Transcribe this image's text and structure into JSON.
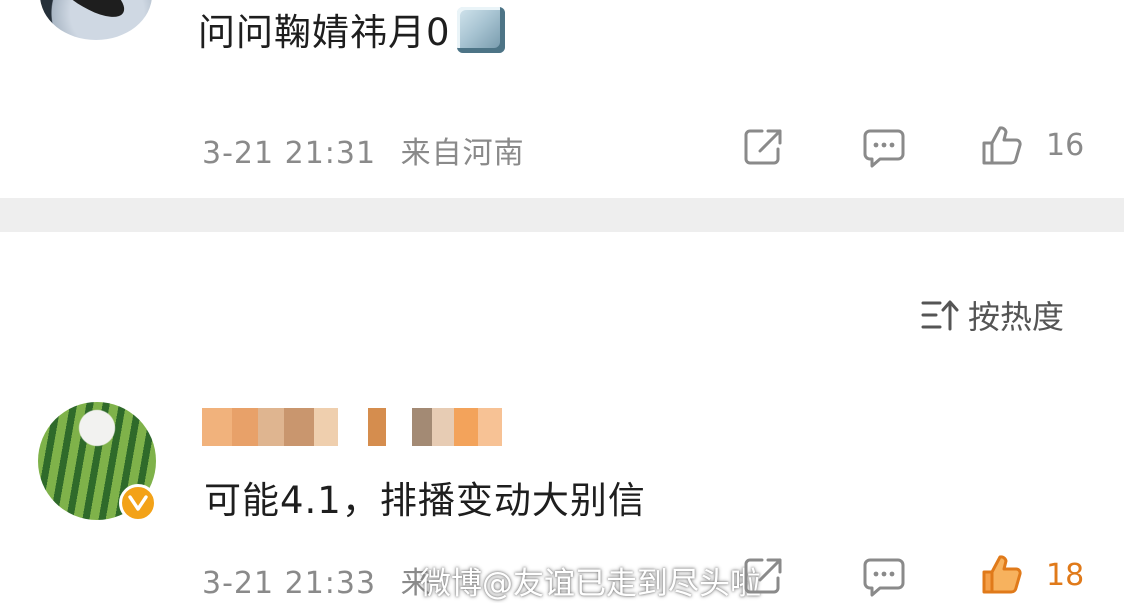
{
  "comment_top": {
    "text": "问问鞠婧祎月0",
    "emoji": "blue-square-emoji",
    "timestamp": "3-21 21:31",
    "location": "来自河南",
    "like_count": "16"
  },
  "sort": {
    "label": "按热度"
  },
  "comment_main": {
    "text": "可能4.1，排播变动大别信",
    "timestamp": "3-21 21:33",
    "location_partial": "来",
    "like_count": "18",
    "liked": true
  },
  "watermark": "微博@友谊已走到尽头啦",
  "colors": {
    "accent": "#f08c1a",
    "meta_gray": "#8a8a8a",
    "divider": "#eeeeee"
  }
}
